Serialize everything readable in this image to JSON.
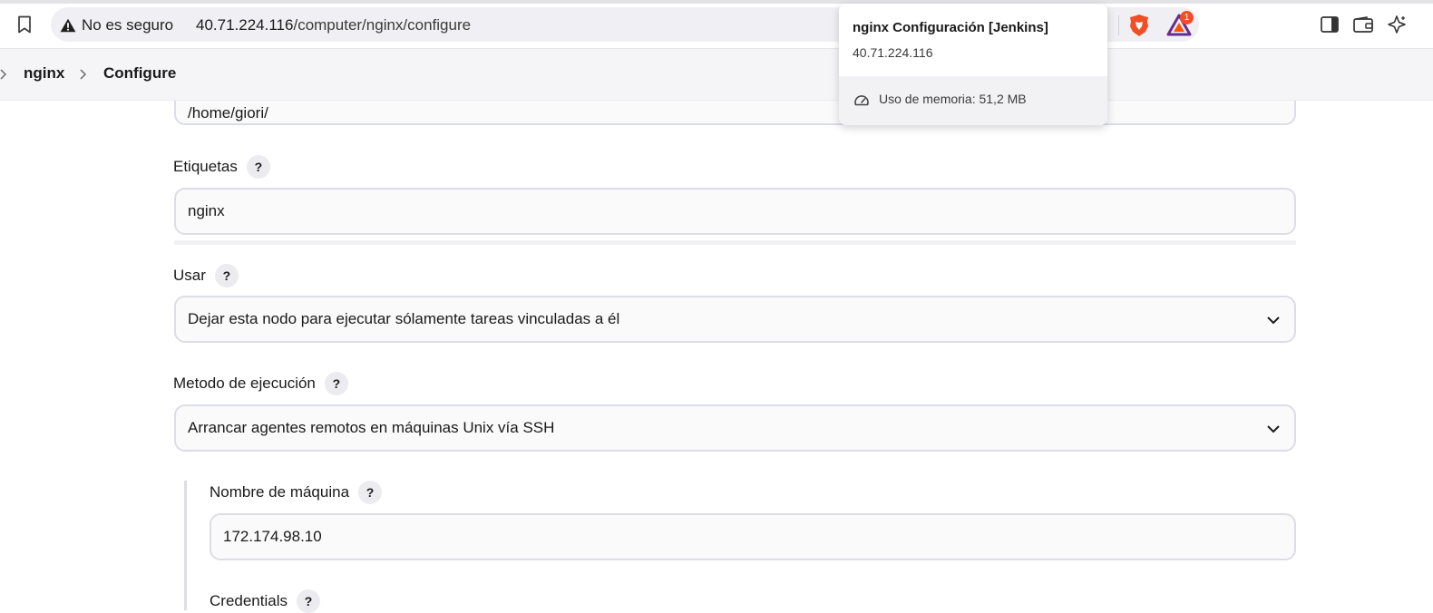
{
  "browser": {
    "security_label": "No es seguro",
    "url_host": "40.71.224.116",
    "url_path": "/computer/nginx/configure",
    "rewards_badge": "1"
  },
  "breadcrumb": {
    "items": [
      "nginx",
      "Configure"
    ]
  },
  "tooltip": {
    "title": "nginx Configuración [Jenkins]",
    "host": "40.71.224.116",
    "memory": "Uso de memoria: 51,2 MB"
  },
  "form": {
    "remote_root_value": "/home/giori/",
    "labels_label": "Etiquetas",
    "labels_value": "nginx",
    "usage_label": "Usar",
    "usage_value": "Dejar esta nodo para ejecutar sólamente tareas vinculadas a él",
    "launch_label": "Metodo de ejecución",
    "launch_value": "Arrancar agentes remotos en máquinas Unix vía SSH",
    "host_label": "Nombre de máquina",
    "host_value": "172.174.98.10",
    "credentials_label": "Credentials",
    "help_glyph": "?"
  },
  "colors": {
    "brave_orange": "#f04f26",
    "bat_purple": "#662d91",
    "field_border": "#dcdde6"
  },
  "icons": [
    "bookmark-icon",
    "warning-icon",
    "share-icon",
    "brave-shields-icon",
    "brave-rewards-icon",
    "sidebar-icon",
    "wallet-icon",
    "leo-ai-icon",
    "chevron-right-icon",
    "chevron-down-icon",
    "gauge-icon",
    "help-icon"
  ]
}
